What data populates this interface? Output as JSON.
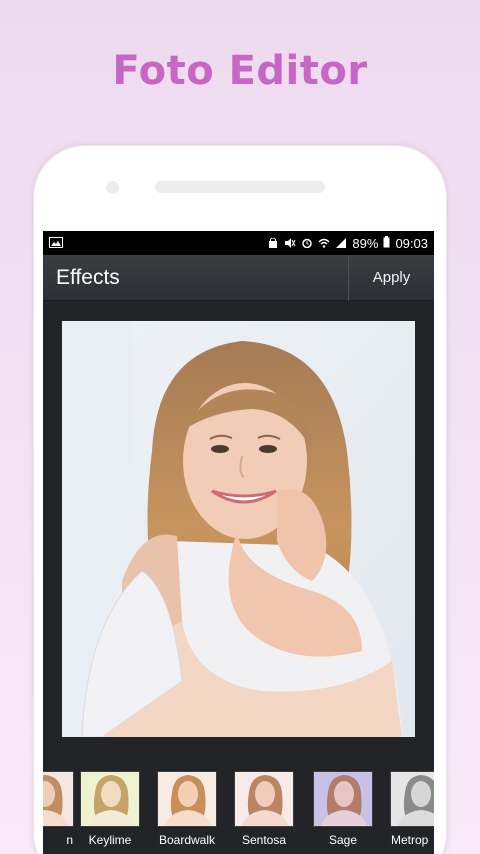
{
  "promo": {
    "title": "Foto Editor"
  },
  "status_bar": {
    "battery": "89%",
    "time": "09:03"
  },
  "app_bar": {
    "title": "Effects",
    "apply_label": "Apply"
  },
  "filters": [
    {
      "label": "n",
      "tint": "#f3e6e3"
    },
    {
      "label": "Keylime",
      "tint": "#eef2cf"
    },
    {
      "label": "Boardwalk",
      "tint": "#f7ece3"
    },
    {
      "label": "Sentosa",
      "tint": "#f7ebe8"
    },
    {
      "label": "Sage",
      "tint": "#c9c2e6"
    },
    {
      "label": "Metrop",
      "tint": "#e6e6e6"
    }
  ],
  "colors": {
    "promo_title": "#c667c5",
    "app_bar": "#2c2f34",
    "screen_bg": "#222428"
  }
}
